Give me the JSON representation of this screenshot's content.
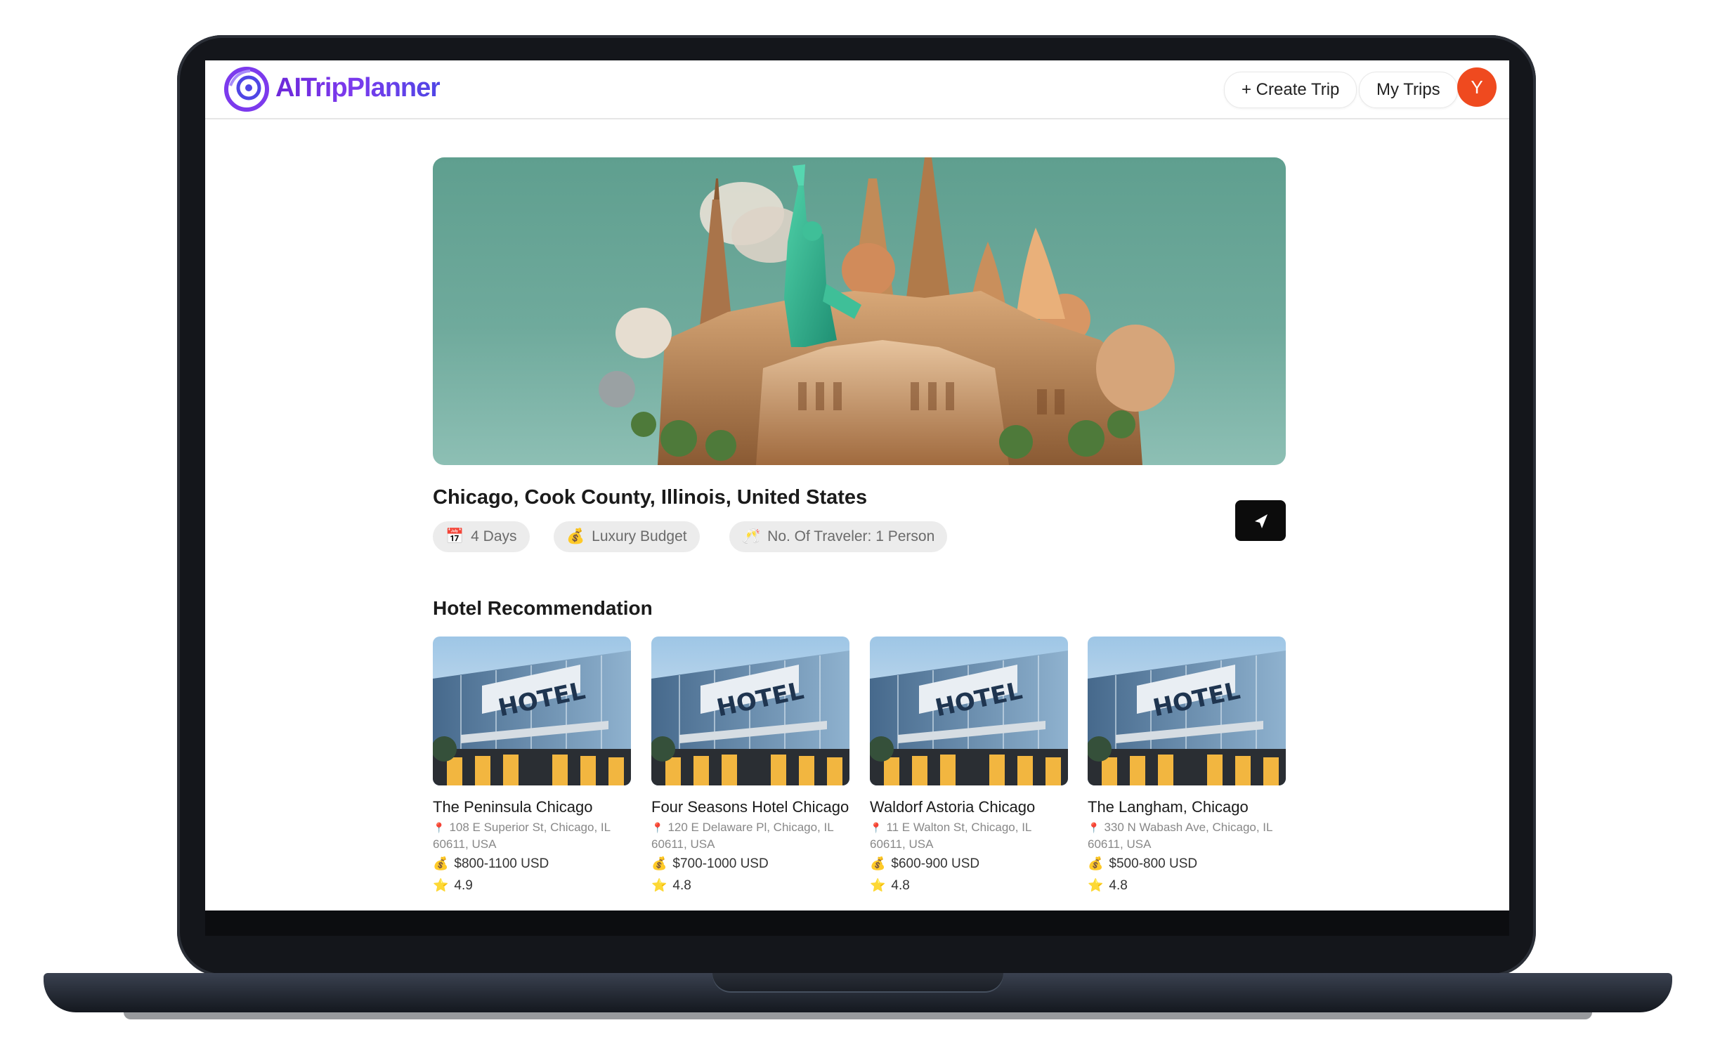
{
  "app": {
    "logo_text": "AITripPlanner"
  },
  "header": {
    "create_trip_label": "+ Create Trip",
    "my_trips_label": "My Trips",
    "avatar_initial": "Y"
  },
  "trip": {
    "location": "Chicago, Cook County, Illinois, United States",
    "days_chip": "4 Days",
    "budget_chip": "Luxury Budget",
    "travelers_chip": "No. Of Traveler: 1 Person"
  },
  "hotels": {
    "section_title": "Hotel Recommendation",
    "items": [
      {
        "name": "The Peninsula Chicago",
        "address": "108 E Superior St, Chicago, IL 60611, USA",
        "price": "$800-1100 USD",
        "rating": "4.9"
      },
      {
        "name": "Four Seasons Hotel Chicago",
        "address": "120 E Delaware Pl, Chicago, IL 60611, USA",
        "price": "$700-1000 USD",
        "rating": "4.8"
      },
      {
        "name": "Waldorf Astoria Chicago",
        "address": "11 E Walton St, Chicago, IL 60611, USA",
        "price": "$600-900 USD",
        "rating": "4.8"
      },
      {
        "name": "The Langham, Chicago",
        "address": "330 N Wabash Ave, Chicago, IL 60611, USA",
        "price": "$500-800 USD",
        "rating": "4.8"
      }
    ]
  },
  "colors": {
    "avatar": "#ef4a1f",
    "brand": "#6d28d9",
    "chip_bg": "#ececec"
  },
  "icons": {
    "share": "send-icon",
    "days": "calendar-icon",
    "budget": "money-bag-icon",
    "travelers": "people-icon",
    "address": "pin-icon",
    "price": "money-icon",
    "rating": "star-icon"
  }
}
